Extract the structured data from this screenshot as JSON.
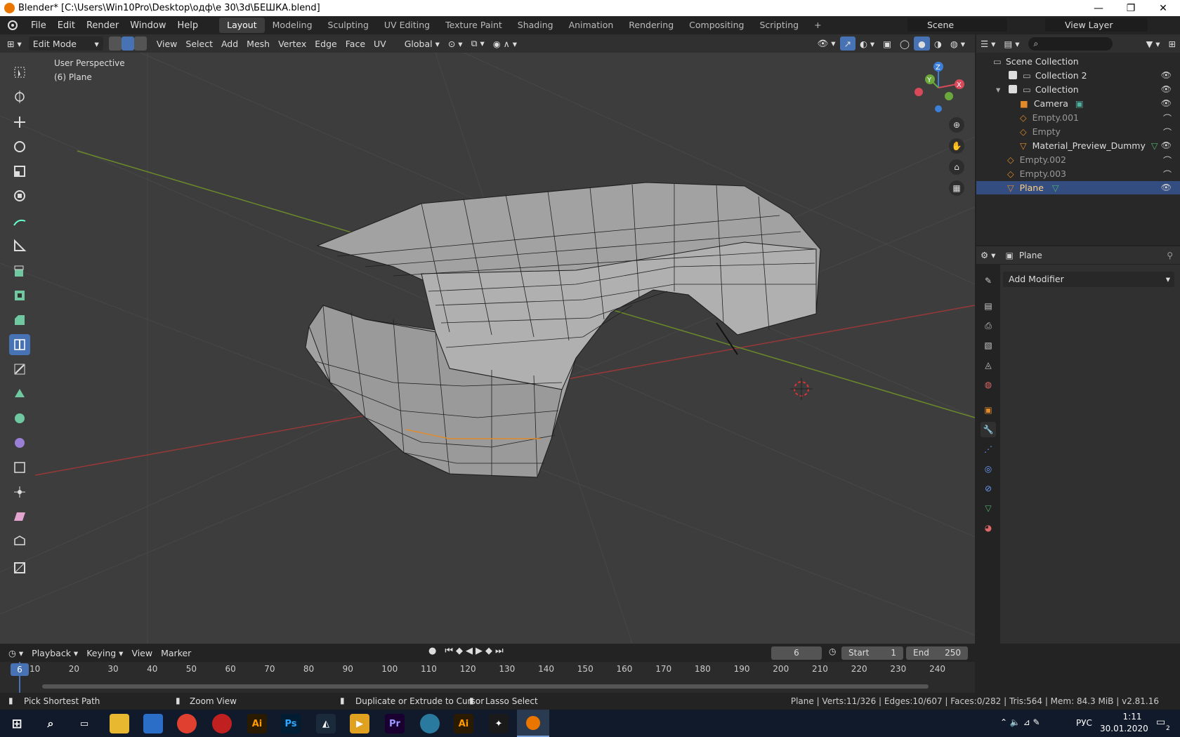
{
  "window": {
    "title": "Blender* [C:\\Users\\Win10Pro\\Desktop\\одф\\e 30\\3d\\БЕШКА.blend]",
    "minimize": "—",
    "maximize": "❐",
    "close": "✕"
  },
  "menu": [
    "File",
    "Edit",
    "Render",
    "Window",
    "Help"
  ],
  "workspaces": [
    "Layout",
    "Modeling",
    "Sculpting",
    "UV Editing",
    "Texture Paint",
    "Shading",
    "Animation",
    "Rendering",
    "Compositing",
    "Scripting"
  ],
  "add_workspace": "+",
  "scene": "Scene",
  "view_layer": "View Layer",
  "header3d": {
    "mode": "Edit Mode",
    "menus": [
      "View",
      "Select",
      "Add",
      "Mesh",
      "Vertex",
      "Edge",
      "Face",
      "UV"
    ],
    "transform": "Global"
  },
  "viewport": {
    "perspective": "User Perspective",
    "object": "(6) Plane",
    "axis_x": "X",
    "axis_y": "Y",
    "axis_z": "Z"
  },
  "outliner": {
    "root": "Scene Collection",
    "items": [
      {
        "name": "Collection 2",
        "checked": true,
        "level": 1
      },
      {
        "name": "Collection",
        "checked": true,
        "level": 1
      },
      {
        "name": "Camera",
        "level": 2
      },
      {
        "name": "Empty.001",
        "level": 2,
        "dim": true
      },
      {
        "name": "Empty",
        "level": 2,
        "dim": true
      },
      {
        "name": "Material_Preview_Dummy",
        "level": 2
      },
      {
        "name": "Empty.002",
        "level": 1,
        "dim": true
      },
      {
        "name": "Empty.003",
        "level": 1,
        "dim": true
      },
      {
        "name": "Plane",
        "level": 1,
        "selected": true
      }
    ]
  },
  "properties": {
    "object": "Plane",
    "add_modifier": "Add Modifier"
  },
  "timeline": {
    "menus": [
      "Playback",
      "Keying",
      "View",
      "Marker"
    ],
    "current_frame": "6",
    "start_label": "Start",
    "start": "1",
    "end_label": "End",
    "end": "250",
    "ticks": [
      "10",
      "20",
      "30",
      "40",
      "50",
      "60",
      "70",
      "80",
      "90",
      "100",
      "110",
      "120",
      "130",
      "140",
      "150",
      "160",
      "170",
      "180",
      "190",
      "200",
      "210",
      "220",
      "230",
      "240"
    ]
  },
  "status": {
    "left1": "Pick Shortest Path",
    "left2": "Zoom View",
    "left3": "Duplicate or Extrude to Cursor",
    "left4": "Lasso Select",
    "right": "Plane | Verts:11/326 | Edges:10/607 | Faces:0/282 | Tris:564 | Mem: 84.3 MiB | v2.81.16"
  },
  "taskbar": {
    "lang": "РУС",
    "time": "1:11",
    "date": "30.01.2020",
    "notif": "2",
    "apps": [
      "Ai",
      "Ps",
      "Pr",
      "Ai"
    ]
  }
}
